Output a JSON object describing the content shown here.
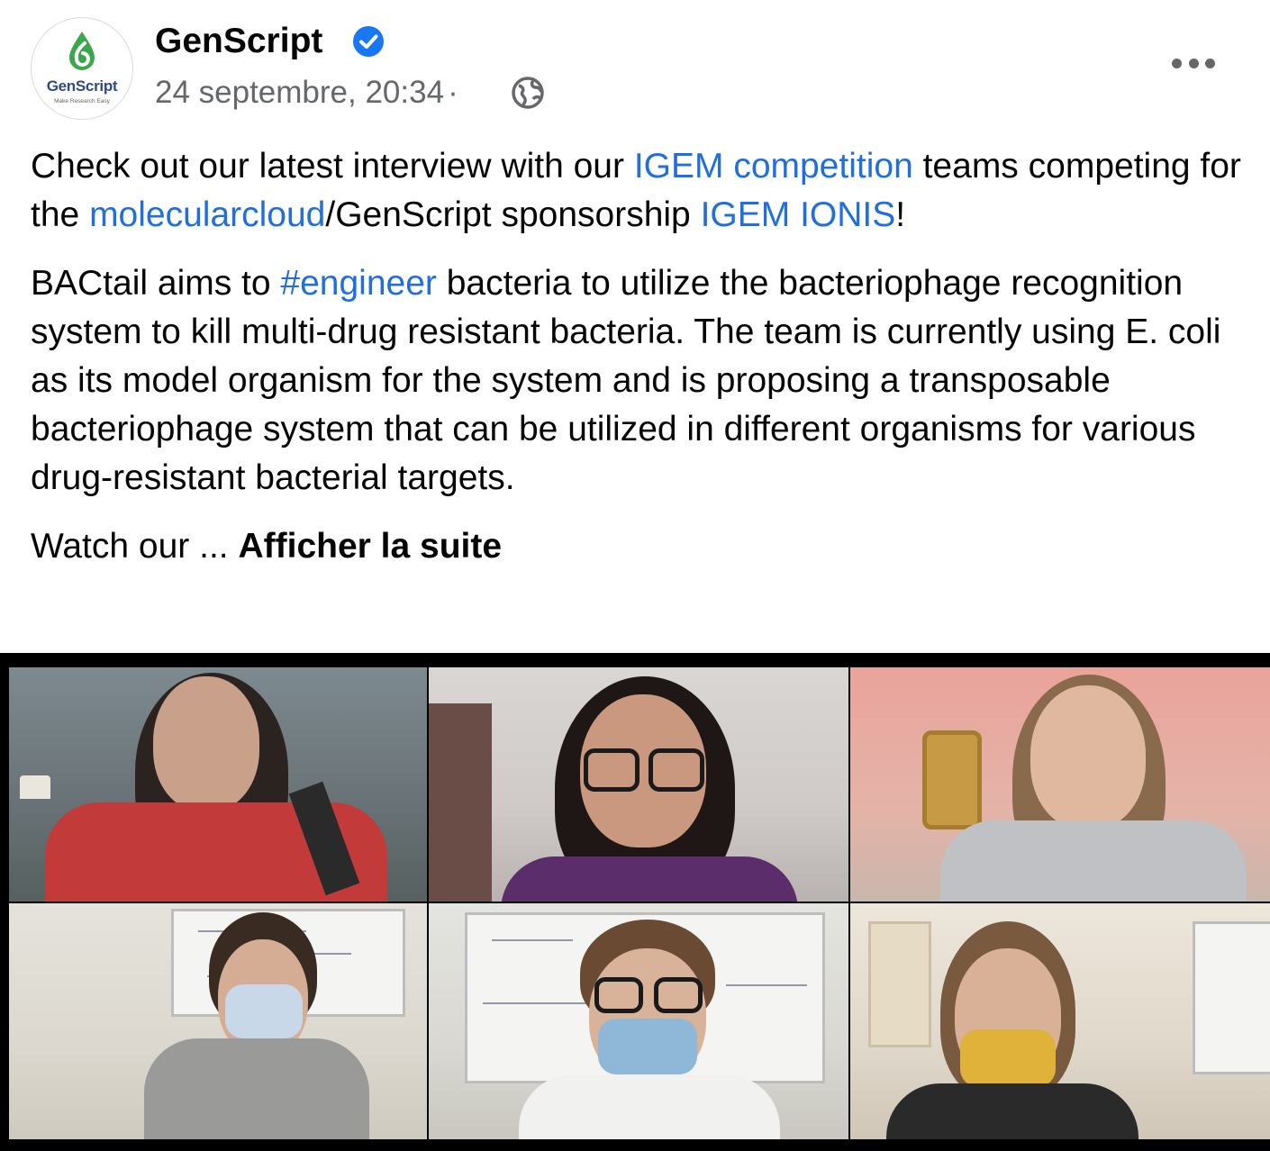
{
  "post": {
    "author": "GenScript",
    "avatar_logo_text": "GenScript",
    "avatar_tagline": "Make Research Easy",
    "date": "24 septembre, 20:34",
    "separator": "·",
    "audience_icon": "globe-icon",
    "verified_icon": "verified-badge-icon",
    "more_icon": "more-horizontal-icon"
  },
  "text": {
    "p1_a": "Check out our latest interview with our ",
    "p1_link1": "IGEM competition",
    "p1_b": " teams competing for the ",
    "p1_link2": "molecularcloud",
    "p1_c": "/GenScript sponsorship ",
    "p1_link3": "IGEM IONIS",
    "p1_d": "!",
    "p2_a": "BACtail aims to ",
    "p2_hashtag": "#engineer",
    "p2_b": " bacteria to utilize the bacteriophage recognition system to kill multi-drug resistant bacteria. The team is currently using E. coli as its model organism for the system and is proposing a transposable bacteriophage system that can be utilized in different organisms for various drug-resistant bacterial targets.",
    "p3_a": "Watch our ... ",
    "see_more": "Afficher la suite"
  },
  "colors": {
    "link": "#216fdb",
    "secondary_text": "#65676b",
    "verified": "#1877f2",
    "logo_green": "#3aa84a"
  }
}
